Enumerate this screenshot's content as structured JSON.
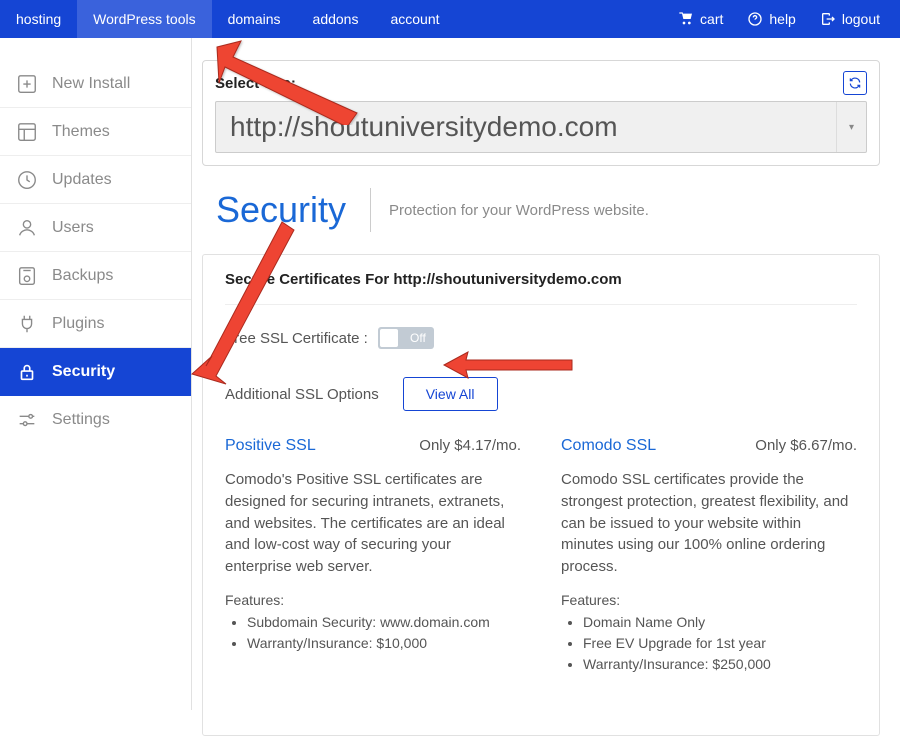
{
  "topnav": {
    "items": [
      "hosting",
      "WordPress tools",
      "domains",
      "addons",
      "account"
    ],
    "active_index": 1,
    "cart": "cart",
    "help": "help",
    "logout": "logout"
  },
  "sidebar": {
    "items": [
      {
        "label": "New Install",
        "icon": "plus-box"
      },
      {
        "label": "Themes",
        "icon": "layout"
      },
      {
        "label": "Updates",
        "icon": "clock"
      },
      {
        "label": "Users",
        "icon": "user"
      },
      {
        "label": "Backups",
        "icon": "disk"
      },
      {
        "label": "Plugins",
        "icon": "plug"
      },
      {
        "label": "Security",
        "icon": "lock"
      },
      {
        "label": "Settings",
        "icon": "sliders"
      }
    ],
    "active_index": 6
  },
  "panel": {
    "select_label": "Select Site:",
    "site_url": "http://shoutuniversitydemo.com"
  },
  "page": {
    "title": "Security",
    "subtitle": "Protection for your WordPress website."
  },
  "card": {
    "heading": "Secure Certificates For http://shoutuniversitydemo.com",
    "free_ssl_label": "Free SSL Certificate :",
    "toggle_state": "Off",
    "additional_label": "Additional SSL Options",
    "viewall": "View All"
  },
  "ssl": [
    {
      "name": "Positive SSL",
      "price": "Only $4.17/mo.",
      "desc": "Comodo's Positive SSL certificates are designed for securing intranets, extranets, and websites. The certificates are an ideal and low-cost way of securing your enterprise web server.",
      "features_title": "Features:",
      "features": [
        "Subdomain Security: www.domain.com",
        "Warranty/Insurance: $10,000"
      ]
    },
    {
      "name": "Comodo SSL",
      "price": "Only $6.67/mo.",
      "desc": "Comodo SSL certificates provide the strongest protection, greatest flexibility, and can be issued to your website within minutes using our 100% online ordering process.",
      "features_title": "Features:",
      "features": [
        "Domain Name Only",
        "Free EV Upgrade for 1st year",
        "Warranty/Insurance: $250,000"
      ]
    }
  ]
}
